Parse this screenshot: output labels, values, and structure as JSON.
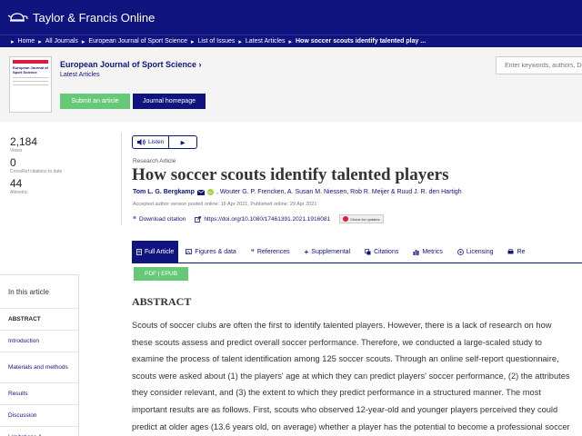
{
  "brand": {
    "name": "Taylor & Francis Online"
  },
  "breadcrumb": {
    "items": [
      "Home",
      "All Journals",
      "European Journal of Sport Science",
      "List of Issues",
      "Latest Articles"
    ],
    "current": "How soccer scouts identify talented play ...",
    "separator": "▸"
  },
  "journal": {
    "title": "European Journal of Sport Science ›",
    "cover_title": "European Journal of Sport Science",
    "latest_link": "Latest Articles",
    "submit_label": "Submit an article",
    "homepage_label": "Journal homepage"
  },
  "search": {
    "placeholder": "Enter keywords, authors, DOI, etc."
  },
  "metrics": [
    {
      "value": "2,184",
      "label": "Views"
    },
    {
      "value": "0",
      "label": "CrossRef citations to date"
    },
    {
      "value": "44",
      "label": "Altmetric"
    }
  ],
  "listen": {
    "label": "Listen",
    "play": "▶"
  },
  "article": {
    "type": "Research Article",
    "title": "How soccer scouts identify talented players",
    "author_first": "Tom L. G. Bergkamp",
    "author_rest": ", Wouter G. P. Frencken, A. Susan M. Niessen, Rob R. Meijer & Ruud J. R. den Hartigh",
    "orcid_label": "iD",
    "dates": "Accepted author version posted online: 16 Apr 2021, Published online: 29 Apr 2021",
    "download": "Download citation",
    "doi": "https://doi.org/10.1080/17461391.2021.1916081",
    "check": "Check for updates"
  },
  "tabs": [
    {
      "label": "Full Article",
      "icon": "document-icon"
    },
    {
      "label": "Figures & data",
      "icon": "image-icon"
    },
    {
      "label": "References",
      "icon": "quote-icon"
    },
    {
      "label": "Supplemental",
      "icon": "plus-icon"
    },
    {
      "label": "Citations",
      "icon": "citation-icon"
    },
    {
      "label": "Metrics",
      "icon": "bar-chart-icon"
    },
    {
      "label": "Licensing",
      "icon": "licensing-icon"
    },
    {
      "label": "Re",
      "icon": "reprints-icon"
    }
  ],
  "pdf": {
    "label": "PDF | EPUB"
  },
  "toc": {
    "heading": "In this article",
    "items": [
      "ABSTRACT",
      "Introduction",
      "Materials and methods",
      "Results",
      "Discussion",
      "Limitations &"
    ]
  },
  "abstract": {
    "heading": "ABSTRACT",
    "text": "Scouts of soccer clubs are often the first to identify talented players. However, there is a lack of research on how these scouts assess and predict overall soccer performance. Therefore, we conducted a large-scaled study to examine the process of talent identification among 125 soccer scouts. Through an online self-report questionnaire, scouts were asked about (1) the players' age at which they can predict players' soccer performance, (2) the attributes they consider relevant, and (3) the extent to which they predict performance in a structured manner. The most important results are as follows. First, scouts who observed 12-year-old and younger players perceived they could predict at older ages (13.6 years old, on average) whether a player has the potential to become a professional soccer player. This suggests that scouts are aware of the"
  },
  "colors": {
    "navy": "#10147e",
    "green": "#67c877"
  }
}
